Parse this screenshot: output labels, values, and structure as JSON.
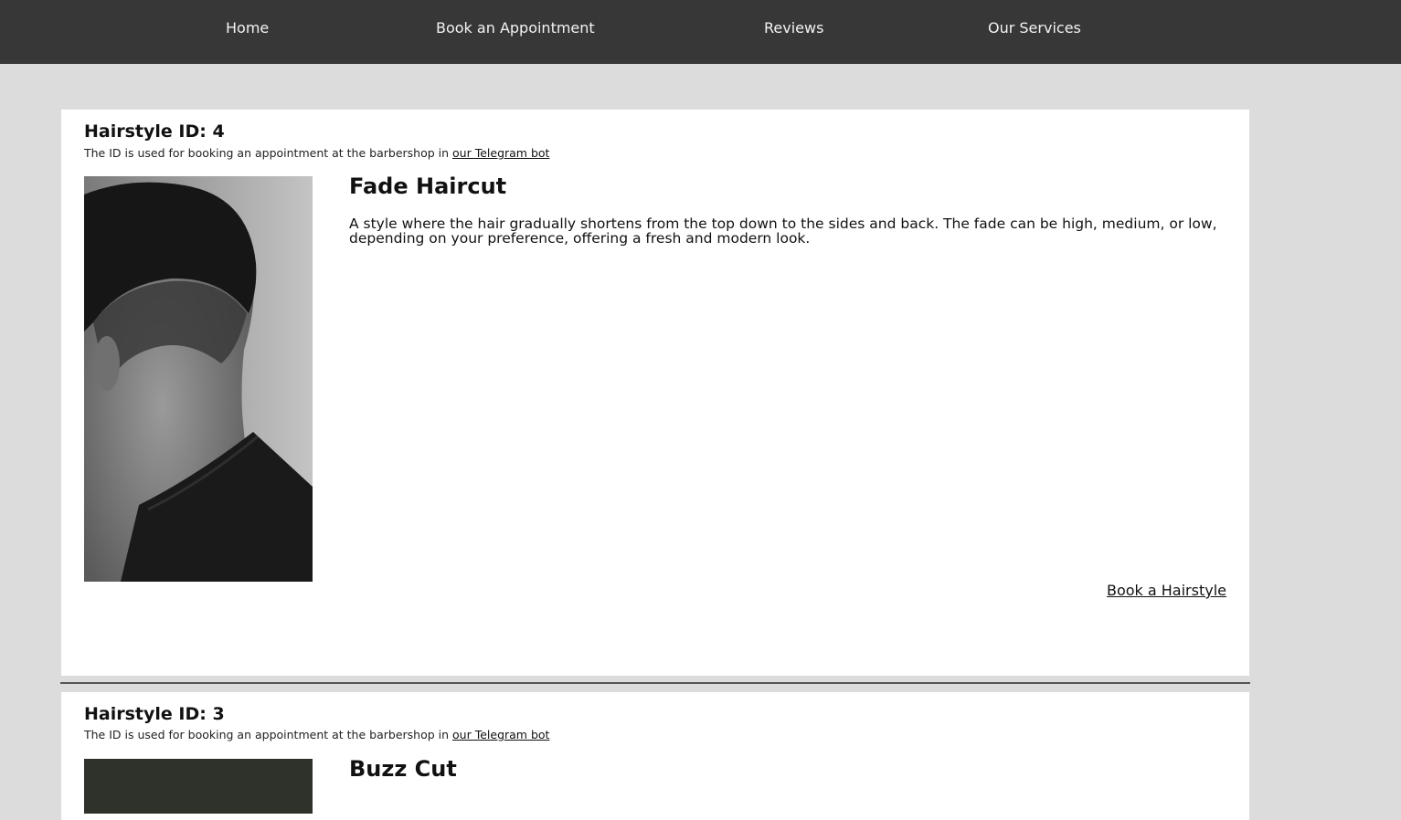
{
  "nav": {
    "items": [
      {
        "label": "Home"
      },
      {
        "label": "Book an Appointment"
      },
      {
        "label": "Reviews"
      },
      {
        "label": "Our Services"
      }
    ]
  },
  "hairstyles": [
    {
      "id_title": "Hairstyle ID: 4",
      "id_note": "The ID is used for booking an appointment at the barbershop in ",
      "telegram_link": "our Telegram bot",
      "name": "Fade Haircut",
      "description": "A style where the hair gradually shortens from the top down to the sides and back. The fade can be high, medium, or low, depending on your preference, offering a fresh and modern look.",
      "book_label": "Book a Hairstyle"
    },
    {
      "id_title": "Hairstyle ID: 3",
      "id_note": "The ID is used for booking an appointment at the barbershop in ",
      "telegram_link": "our Telegram bot",
      "name": "Buzz Cut"
    }
  ],
  "colors": {
    "nav_bg": "#373737",
    "page_bg": "#dcdcdc",
    "card_bg": "#ffffff"
  }
}
